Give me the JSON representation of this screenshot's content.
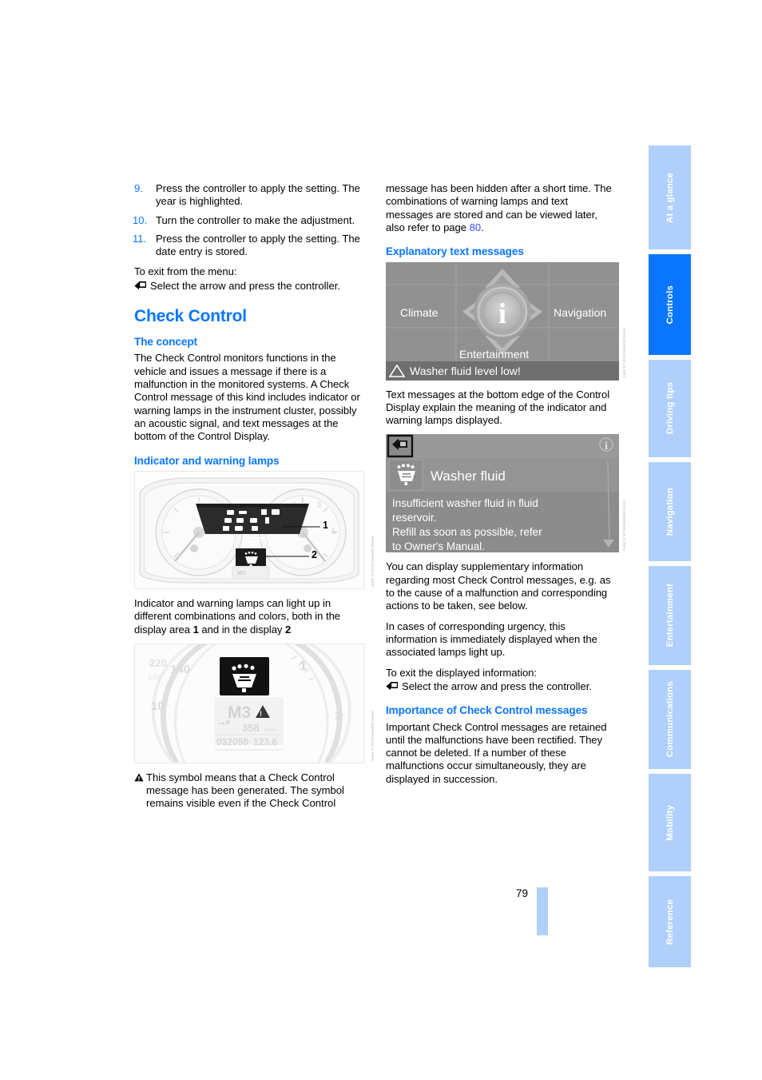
{
  "page": {
    "number": "79",
    "accent_blue": "#0a76ff",
    "tab_inactive_blue": "#b0d0fb",
    "link_blue": "#3355ff"
  },
  "tabs": [
    {
      "label": "At a glance",
      "active": false
    },
    {
      "label": "Controls",
      "active": true
    },
    {
      "label": "Driving tips",
      "active": false
    },
    {
      "label": "Navigation",
      "active": false
    },
    {
      "label": "Entertainment",
      "active": false
    },
    {
      "label": "Communications",
      "active": false
    },
    {
      "label": "Mobility",
      "active": false
    },
    {
      "label": "Reference",
      "active": false
    }
  ],
  "left_column": {
    "steps": [
      {
        "num": "9.",
        "text": "Press the controller to apply the setting. The year is highlighted."
      },
      {
        "num": "10.",
        "text": "Turn the controller to make the adjustment."
      },
      {
        "num": "11.",
        "text": "Press the controller to apply the setting. The date entry is stored."
      }
    ],
    "exit_intro": "To exit from the menu:",
    "exit_action": "Select the arrow and press the controller.",
    "section_title": "Check Control",
    "concept_title": "The concept",
    "concept_text": "The Check Control monitors functions in the vehicle and issues a message if there is a malfunction in the monitored systems. A Check Control message of this kind includes indicator or warning lamps in the instrument cluster, possibly an acoustic signal, and text messages at the bottom of the Control Display.",
    "lamps_title": "Indicator and warning lamps",
    "cluster_figure": {
      "callout_1": "1",
      "callout_2": "2",
      "fig_code": "WWW.BMWMANUALS.INFO"
    },
    "lamps_caption_a": "Indicator and warning lamps can light up in different combinations and colors, both in the display area ",
    "lamps_caption_bold1": "1",
    "lamps_caption_b": " and in the display ",
    "lamps_caption_bold2": "2",
    "cluster_detail_figure": {
      "gear": "M3",
      "range": "358",
      "range_unit": "miles",
      "odometer": "032050",
      "trip": "123.6",
      "fig_code": "WWW.BMWMANUALS.INFO"
    },
    "symbol_note": "This symbol means that a Check Control message has been generated. The symbol remains visible even if the Check Control"
  },
  "right_column": {
    "continuation": "message has been hidden after a short time. The combinations of warning lamps and text messages are stored and can be viewed later, also refer to page ",
    "continuation_link": "80",
    "continuation_end": ".",
    "explanatory_title": "Explanatory text messages",
    "idrive_menu": {
      "climate": "Climate",
      "navigation": "Navigation",
      "entertainment": "Entertainment",
      "center_icon": "info-icon",
      "status_message": "Washer fluid level low!",
      "fig_code": "WWW.BMWMANUALS.INFO"
    },
    "explanatory_text": "Text messages at the bottom edge of the Control Display explain the meaning of the indicator and warning lamps displayed.",
    "idrive_detail": {
      "title": "Washer fluid",
      "body_line_1": "Insufficient washer fluid in fluid",
      "body_line_2": "reservoir.",
      "body_line_3": "Refill as soon as possible, refer",
      "body_line_4": "to Owner's Manual.",
      "back_icon": "back-arrow-icon",
      "info_icon": "info-icon",
      "scroll_icon": "scroll-down-icon",
      "fig_code": "WWW.BMWMANUALS.INFO"
    },
    "supplementary_text": "You can display supplementary information regarding most Check Control messages, e.g. as to the cause of a malfunction and corresponding actions to be taken, see below.",
    "urgency_text": "In cases of corresponding urgency, this information is immediately displayed when the associated lamps light up.",
    "exit_intro": "To exit the displayed information:",
    "exit_action": "Select the arrow and press the controller.",
    "importance_title": "Importance of Check Control messages",
    "importance_text": "Important Check Control messages are retained until the malfunctions have been rectified. They cannot be deleted. If a number of these malfunctions occur simultaneously, they are displayed in succession."
  }
}
